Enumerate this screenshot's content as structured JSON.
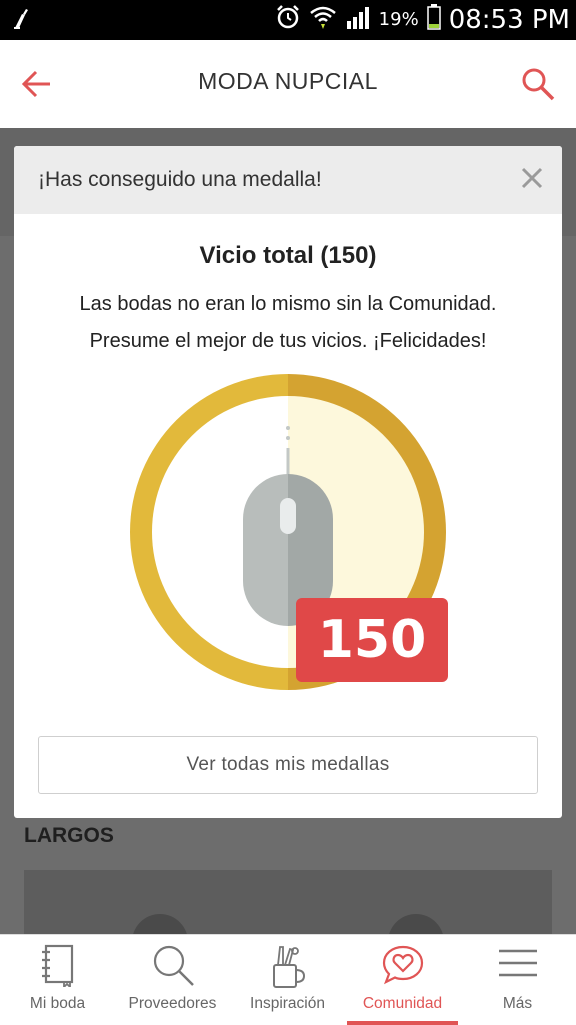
{
  "status_bar": {
    "battery_percent": "19%",
    "time": "08:53 PM"
  },
  "header": {
    "title": "MODA NUPCIAL"
  },
  "background": {
    "section_label": "LARGOS"
  },
  "modal": {
    "header_title": "¡Has conseguido una medalla!",
    "medal_name": "Vicio total (150)",
    "description_line1": "Las bodas no eran lo mismo sin la Comunidad.",
    "description_line2": "Presume el mejor de tus vicios. ¡Felicidades!",
    "badge_count": "150",
    "button_label": "Ver todas mis medallas"
  },
  "bottom_nav": {
    "items": [
      {
        "label": "Mi boda",
        "icon": "notebook-icon"
      },
      {
        "label": "Proveedores",
        "icon": "search-icon"
      },
      {
        "label": "Inspiración",
        "icon": "pencil-cup-icon"
      },
      {
        "label": "Comunidad",
        "icon": "heart-chat-icon",
        "active": true
      },
      {
        "label": "Más",
        "icon": "menu-icon"
      }
    ]
  },
  "colors": {
    "accent": "#e05555",
    "badge_red": "#e04848",
    "medal_gold": "#e2b93b",
    "medal_gold_dark": "#d4a331"
  }
}
